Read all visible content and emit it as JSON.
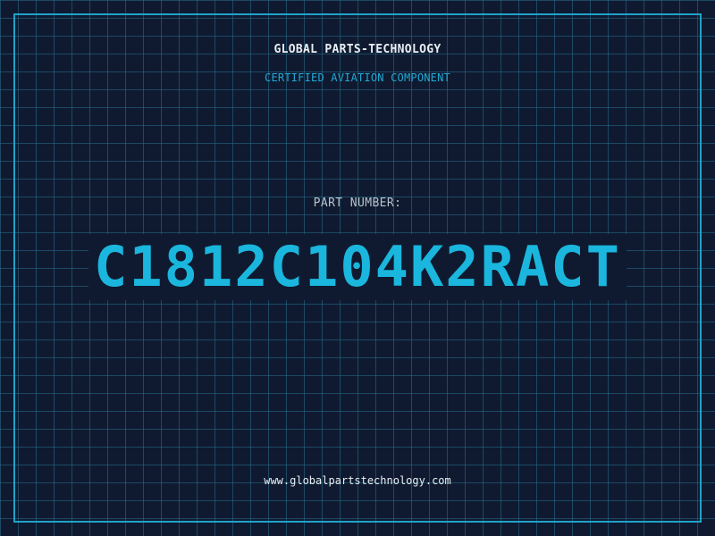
{
  "header": {
    "title": "GLOBAL PARTS-TECHNOLOGY",
    "subtitle": "CERTIFIED AVIATION COMPONENT"
  },
  "part": {
    "label": "PART NUMBER:",
    "number": "C1812C104K2RACT"
  },
  "footer": {
    "url": "www.globalpartstechnology.com"
  },
  "colors": {
    "background": "#0f1a30",
    "grid": "#286e8c",
    "accent": "#1ab6dd",
    "frame": "#1fa3c8",
    "text": "#e8eef3"
  }
}
